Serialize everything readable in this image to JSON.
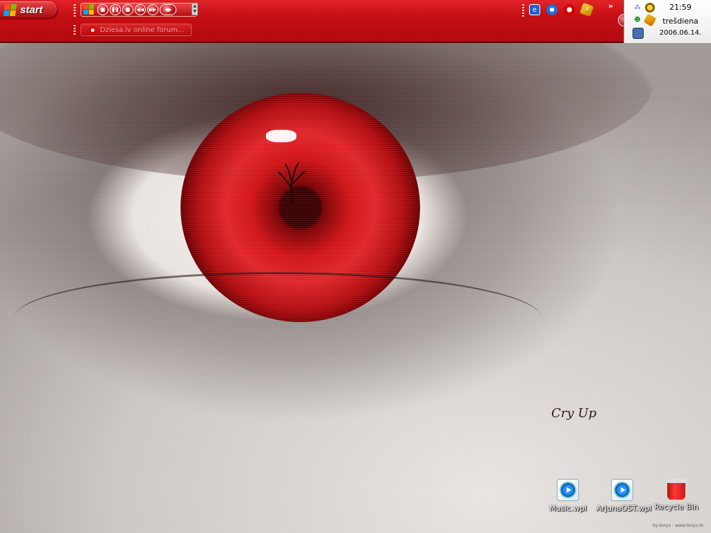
{
  "taskbar": {
    "start_label": "start",
    "task_button_label": "Dziesa.lv online forum...",
    "chevron": "»",
    "colors": {
      "bar": "#c40f14",
      "accent": "#ffffff"
    }
  },
  "media_controls": [
    {
      "name": "windows-media-logo",
      "icon": "windows-flag-icon"
    },
    {
      "name": "stop-button",
      "glyph": "■"
    },
    {
      "name": "pause-button",
      "glyph": "❚❚"
    },
    {
      "name": "stop-button-2",
      "glyph": "■"
    },
    {
      "name": "previous-button",
      "glyph": "◀◀"
    },
    {
      "name": "next-button",
      "glyph": "▶▶"
    },
    {
      "name": "volume-button",
      "glyph": "◀▶"
    }
  ],
  "quick_launch": [
    {
      "name": "internet-explorer-icon"
    },
    {
      "name": "windows-media-player-icon"
    },
    {
      "name": "opera-icon"
    },
    {
      "name": "winamp-icon"
    }
  ],
  "tray": {
    "icons": [
      "network-icon",
      "globe-icon",
      "messenger-icon",
      "pencil-icon",
      "monitor-icon"
    ],
    "time": "21:59",
    "day": "trešdiena",
    "date": "2006.06.14."
  },
  "desktop": {
    "wallpaper_text": "Cry Up",
    "credit": "by-tonyx - www.tonyx.tk",
    "icons": [
      {
        "label": "Music.wpl",
        "icon": "wmp-playlist-icon"
      },
      {
        "label": "ArjunaOST.wpl",
        "icon": "wmp-playlist-icon"
      },
      {
        "label": "Recycle Bin",
        "icon": "recycle-bin-icon"
      }
    ]
  }
}
